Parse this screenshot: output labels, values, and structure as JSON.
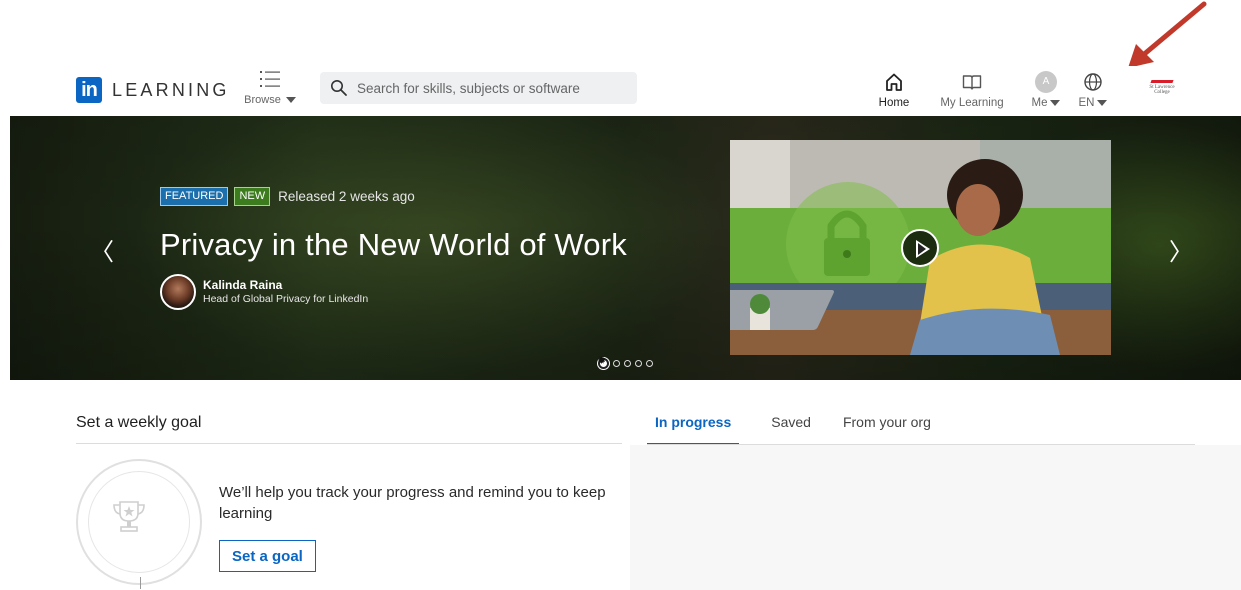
{
  "header": {
    "logo_text": "LEARNING",
    "logo_badge": "in",
    "browse_label": "Browse",
    "search_placeholder": "Search for skills, subjects or software",
    "nav": {
      "home": "Home",
      "my_learning": "My Learning",
      "me": "Me",
      "me_avatar_letter": "A",
      "language": "EN"
    },
    "org_logo_text": "St Lawrence College"
  },
  "hero": {
    "badges": {
      "featured": "FEATURED",
      "new": "NEW"
    },
    "released": "Released 2 weeks ago",
    "title": "Privacy in the New World of Work",
    "author_name": "Kalinda Raina",
    "author_role": "Head of Global Privacy for LinkedIn",
    "prev_arrow": "〈",
    "next_arrow": "〉",
    "carousel": {
      "total": 5,
      "active": 1
    }
  },
  "goal": {
    "title": "Set a weekly goal",
    "text": "We’ll help you track your progress and remind you to keep learning",
    "button": "Set a goal"
  },
  "tabs": [
    {
      "label": "In progress",
      "active": true
    },
    {
      "label": "Saved",
      "active": false
    },
    {
      "label": "From your org",
      "active": false
    }
  ],
  "colors": {
    "brand": "#0a66c2",
    "featured_badge": "#1b6fad",
    "new_badge": "#3c7c1f",
    "annotation_arrow": "#c0392b"
  }
}
